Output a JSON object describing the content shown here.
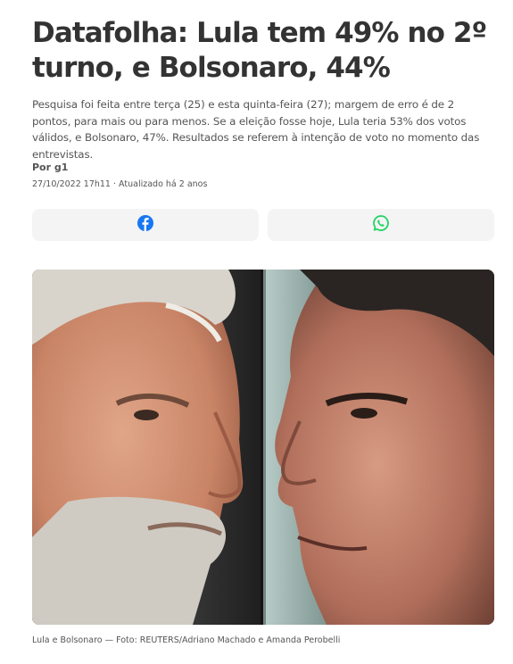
{
  "article": {
    "headline": "Datafolha: Lula tem 49% no 2º turno, e Bolsonaro, 44%",
    "summary": "Pesquisa foi feita entre terça (25) e esta quinta-feira (27); margem de erro é de 2 pontos, para mais ou para menos. Se a eleição fosse hoje, Lula teria 53% dos votos válidos, e Bolsonaro, 47%. Resultados se referem à intenção de voto no momento das entrevistas.",
    "byline_prefix": "Por ",
    "author": "g1",
    "published": "27/10/2022 17h11",
    "separator": " · ",
    "updated": "Atualizado há 2 anos"
  },
  "share": {
    "facebook_icon": "facebook-icon",
    "whatsapp_icon": "whatsapp-icon",
    "facebook_color": "#1877f2",
    "whatsapp_color": "#25d366"
  },
  "photo": {
    "caption": "Lula e Bolsonaro — Foto: REUTERS/Adriano Machado e Amanda Perobelli"
  }
}
